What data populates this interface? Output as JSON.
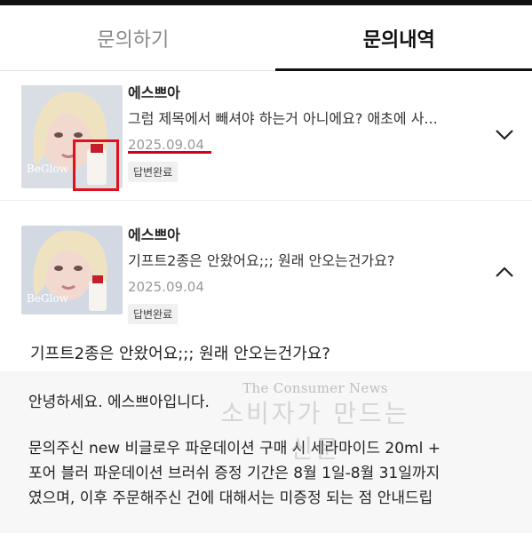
{
  "tabs": [
    {
      "label": "문의하기",
      "active": false
    },
    {
      "label": "문의내역",
      "active": true
    }
  ],
  "inquiries": [
    {
      "seller": "에스쁘아",
      "title": "그럼 제목에서 빼셔야 하는거 아니에요? 애초에 사...",
      "date": "2025.09.04",
      "status": "답변완료",
      "expanded": false,
      "chevron": "chevron-down-icon"
    },
    {
      "seller": "에스쁘아",
      "title": "기프트2종은 안왔어요;;; 원래 안오는건가요?",
      "date": "2025.09.04",
      "status": "답변완료",
      "expanded": true,
      "chevron": "chevron-up-icon"
    }
  ],
  "detail": {
    "question": "기프트2종은 안왔어요;;; 원래 안오는건가요?",
    "greeting": "안녕하세요. 에스쁘아입니다.",
    "body_lines": [
      "문의주신 new 비글로우 파운데이션 구매 시 세라마이드 20ml +",
      "포어 블러 파운데이션 브러쉬 증정 기간은 8월 1일-8월 31일까지",
      "였으며, 이후 주문해주신 건에 대해서는 미증정 되는 점 안내드립"
    ]
  },
  "watermark": {
    "en": "The Consumer News",
    "ko": "소비자가 만드는 신문"
  },
  "colors": {
    "accent": "#111111",
    "highlight_red": "#e0101c",
    "date_gray": "#999999"
  }
}
